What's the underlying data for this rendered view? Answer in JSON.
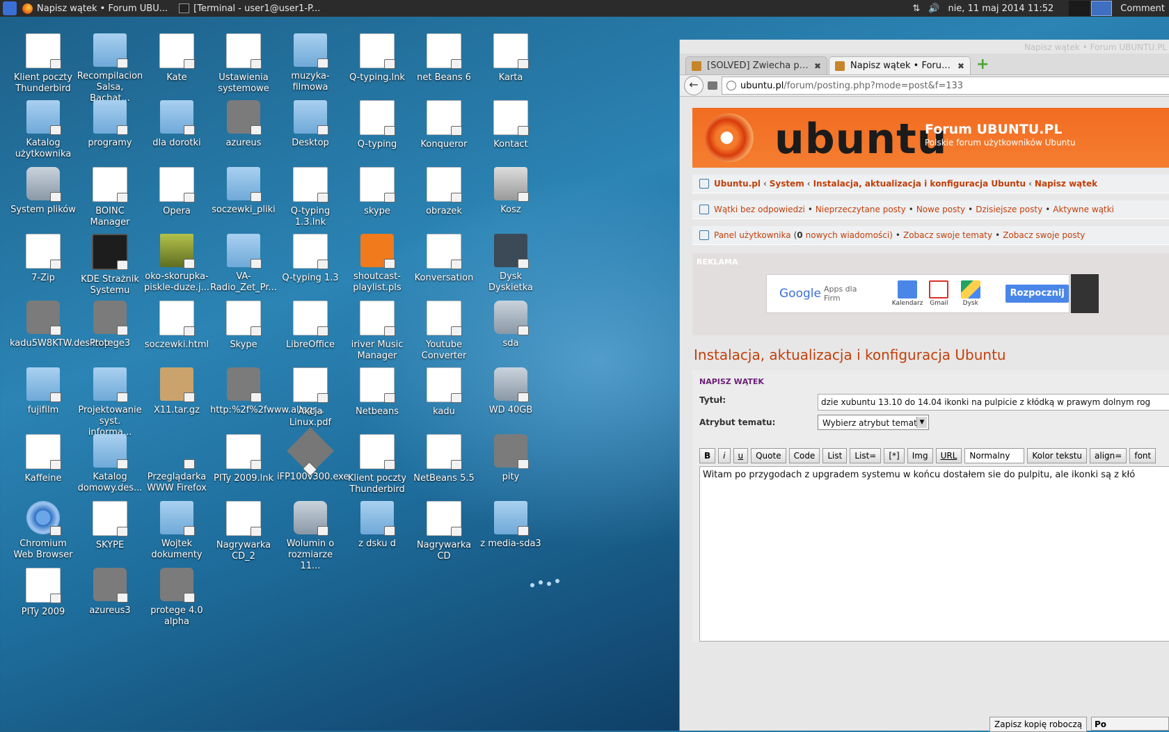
{
  "panel": {
    "windows": [
      {
        "label": "Napisz wątek • Forum UBU...",
        "icon": "firefox-icon"
      },
      {
        "label": "[Terminal - user1@user1-P...",
        "icon": "terminal-icon"
      }
    ],
    "clock": "nie, 11 maj 2014 11:52",
    "comment_label": "Comment"
  },
  "desktop_icons": [
    {
      "label": "Klient poczty Thunderbird",
      "type": "doc"
    },
    {
      "label": "Recompilacion Salsa, Bachat...",
      "type": "folder"
    },
    {
      "label": "Kate",
      "type": "doc"
    },
    {
      "label": "Ustawienia systemowe",
      "type": "doc"
    },
    {
      "label": "muzyka-filmowa",
      "type": "folder"
    },
    {
      "label": "Q-typing.lnk",
      "type": "doc"
    },
    {
      "label": "net Beans 6",
      "type": "doc"
    },
    {
      "label": "Karta",
      "type": "doc"
    },
    {
      "label": "Katalog użytkownika",
      "type": "folder"
    },
    {
      "label": "programy",
      "type": "folder"
    },
    {
      "label": "dla dorotki",
      "type": "folder"
    },
    {
      "label": "azureus",
      "type": "gear"
    },
    {
      "label": "Desktop",
      "type": "folder"
    },
    {
      "label": "Q-typing",
      "type": "doc"
    },
    {
      "label": "Konqueror",
      "type": "doc"
    },
    {
      "label": "Kontact",
      "type": "doc"
    },
    {
      "label": "System plików",
      "type": "disk"
    },
    {
      "label": "BOINC Manager",
      "type": "doc"
    },
    {
      "label": "Opera",
      "type": "doc"
    },
    {
      "label": "soczewki_pliki",
      "type": "folder"
    },
    {
      "label": "Q-typing 1.3.lnk",
      "type": "doc"
    },
    {
      "label": "skype",
      "type": "doc"
    },
    {
      "label": "obrazek",
      "type": "doc"
    },
    {
      "label": "Kosz",
      "type": "trash"
    },
    {
      "label": "7-Zip",
      "type": "doc"
    },
    {
      "label": "KDE Strażnik Systemu",
      "type": "monitor"
    },
    {
      "label": "oko-skorupka-piskle-duze.j...",
      "type": "photo"
    },
    {
      "label": "VA-Radio_Zet_Pr...",
      "type": "folder"
    },
    {
      "label": "Q-typing 1.3",
      "type": "doc"
    },
    {
      "label": "shoutcast-playlist.pls",
      "type": "orange"
    },
    {
      "label": "Konversation",
      "type": "doc"
    },
    {
      "label": "Dysk Dyskietka",
      "type": "floppy"
    },
    {
      "label": "kadu5W8KTW.desktop",
      "type": "gear"
    },
    {
      "label": "Protege3",
      "type": "gear"
    },
    {
      "label": "soczewki.html",
      "type": "doc"
    },
    {
      "label": "Skype",
      "type": "doc"
    },
    {
      "label": "LibreOffice",
      "type": "doc"
    },
    {
      "label": "iriver Music Manager",
      "type": "doc"
    },
    {
      "label": "Youtube Converter",
      "type": "doc"
    },
    {
      "label": "sda",
      "type": "disk"
    },
    {
      "label": "fujifilm",
      "type": "folder"
    },
    {
      "label": "Projektowanie syst. informa...",
      "type": "folder"
    },
    {
      "label": "X11.tar.gz",
      "type": "tar"
    },
    {
      "label": "http:%2f%2fwww.allegr...",
      "type": "gear"
    },
    {
      "label": "Akcja Linux.pdf",
      "type": "pdf"
    },
    {
      "label": "Netbeans",
      "type": "doc"
    },
    {
      "label": "kadu",
      "type": "doc"
    },
    {
      "label": "WD 40GB",
      "type": "disk"
    },
    {
      "label": "Kaffeine",
      "type": "doc"
    },
    {
      "label": "Katalog domowy.des...",
      "type": "folder"
    },
    {
      "label": "Przeglądarka WWW Firefox",
      "type": "firefox"
    },
    {
      "label": "PITy 2009.lnk",
      "type": "doc"
    },
    {
      "label": "iFP100v300.exe",
      "type": "exe"
    },
    {
      "label": "Klient poczty Thunderbird",
      "type": "doc"
    },
    {
      "label": "NetBeans 5.5",
      "type": "doc"
    },
    {
      "label": "pity",
      "type": "gear"
    },
    {
      "label": "Chromium Web Browser",
      "type": "chromium"
    },
    {
      "label": "SKYPE",
      "type": "doc"
    },
    {
      "label": "Wojtek dokumenty",
      "type": "folder"
    },
    {
      "label": "Nagrywarka CD_2",
      "type": "doc"
    },
    {
      "label": "Wolumin o rozmiarze 11...",
      "type": "disk"
    },
    {
      "label": "z dsku d",
      "type": "folder"
    },
    {
      "label": "Nagrywarka CD",
      "type": "doc"
    },
    {
      "label": "z media-sda3",
      "type": "folder"
    },
    {
      "label": "PITy 2009",
      "type": "doc"
    },
    {
      "label": "azureus3",
      "type": "gear"
    },
    {
      "label": "protege 4.0 alpha",
      "type": "gear"
    }
  ],
  "browser": {
    "window_title": "Napisz wątek • Forum UBUNTU.PL",
    "tabs": [
      {
        "label": "[SOLVED] Zwiecha podc...",
        "active": false
      },
      {
        "label": "Napisz wątek • Forum ...",
        "active": true
      }
    ],
    "url_host": "ubuntu.pl",
    "url_path": "/forum/posting.php?mode=post&f=133",
    "banner": {
      "wordmark": "ubuntu",
      "forum_title": "Forum UBUNTU.PL",
      "forum_subtitle": "Polskie forum użytkowników Ubuntu"
    },
    "breadcrumb": [
      "Ubuntu.pl",
      "System",
      "Instalacja, aktualizacja i konfiguracja Ubuntu",
      "Napisz wątek"
    ],
    "quick_links": [
      "Wątki bez odpowiedzi",
      "Nieprzeczytane posty",
      "Nowe posty",
      "Dzisiejsze posty",
      "Aktywne wątki"
    ],
    "user_links": {
      "panel": "Panel użytkownika",
      "count": "0",
      "messages": "nowych wiadomości)",
      "topics": "Zobacz swoje tematy",
      "posts": "Zobacz swoje posty"
    },
    "ad": {
      "label": "REKLAMA",
      "google": "Google",
      "apps": "Apps dla Firm",
      "items": [
        "Kalendarz",
        "Gmail",
        "Dysk"
      ],
      "button": "Rozpocznij"
    },
    "forum_heading": "Instalacja, aktualizacja i konfiguracja Ubuntu",
    "post_form": {
      "heading": "NAPISZ WĄTEK",
      "title_label": "Tytuł:",
      "title_value": "dzie xubuntu 13.10 do 14.04 ikonki na pulpicie z kłódką w prawym dolnym rog",
      "attr_label": "Atrybut tematu:",
      "attr_value": "Wybierz atrybut tematu",
      "toolbar": [
        "B",
        "i",
        "u",
        "Quote",
        "Code",
        "List",
        "List=",
        "[*]",
        "Img",
        "URL",
        "Normalny",
        "Kolor tekstu",
        "align=",
        "font"
      ],
      "body": "Witam po przygodach z upgradem systemu w końcu dostałem sie do pulpitu, ale ikonki są z kłó",
      "save_draft": "Zapisz kopię roboczą",
      "post_btn": "Po"
    }
  }
}
